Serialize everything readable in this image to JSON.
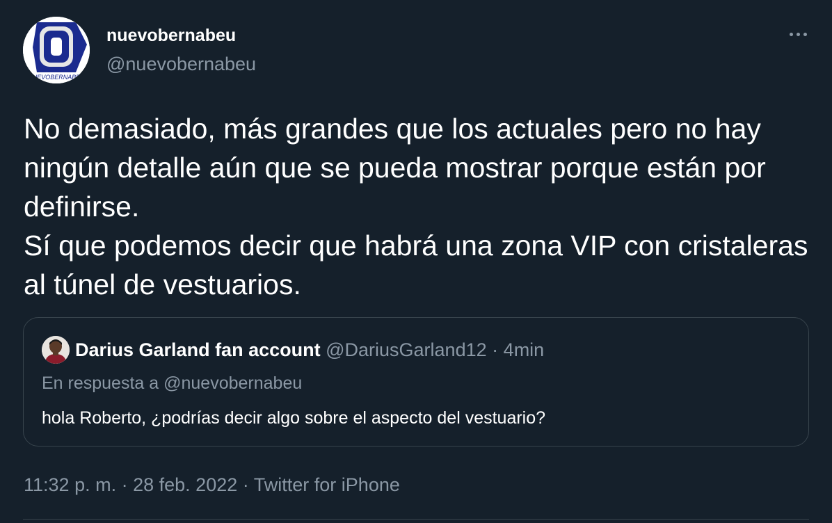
{
  "author": {
    "name": "nuevobernabeu",
    "handle": "@nuevobernabeu",
    "avatar_logo_letter": "O",
    "avatar_logo_text": "NUEVOBERNABEU"
  },
  "tweet": {
    "paragraphs": [
      "No demasiado, más grandes que los actuales pero no hay ningún detalle aún que se pueda mostrar porque están por definirse.",
      "Sí que podemos decir que habrá una zona VIP con cristaleras al túnel de vestuarios."
    ]
  },
  "quoted": {
    "name": "Darius Garland fan account",
    "handle": "@DariusGarland12",
    "separator": "·",
    "time": "4min",
    "reply_prefix": "En respuesta a",
    "reply_to": "@nuevobernabeu",
    "text": "hola Roberto, ¿podrías decir algo sobre el aspecto del vestuario?"
  },
  "meta": {
    "time": "11:32 p. m.",
    "sep1": "·",
    "date": "28 feb. 2022",
    "sep2": "·",
    "source": "Twitter for iPhone"
  },
  "icons": {
    "more": "more-horizontal-icon"
  },
  "colors": {
    "background": "#15202b",
    "text": "#ffffff",
    "secondary": "#8b98a5",
    "border": "#38444d"
  }
}
